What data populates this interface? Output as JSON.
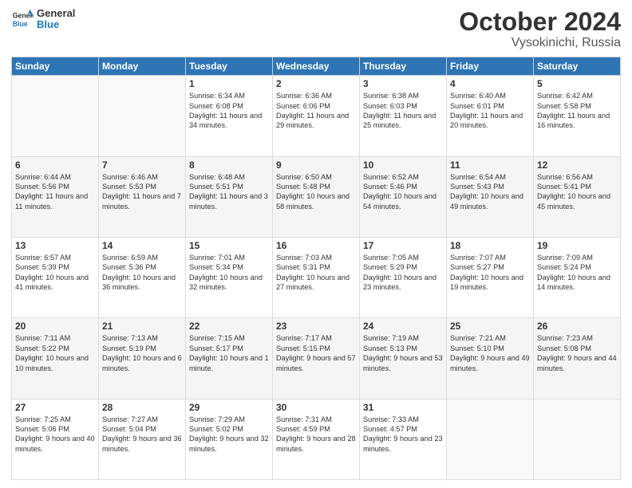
{
  "logo": {
    "line1": "General",
    "line2": "Blue"
  },
  "title": "October 2024",
  "subtitle": "Vysokinichi, Russia",
  "days_header": [
    "Sunday",
    "Monday",
    "Tuesday",
    "Wednesday",
    "Thursday",
    "Friday",
    "Saturday"
  ],
  "weeks": [
    [
      {
        "day": "",
        "sunrise": "",
        "sunset": "",
        "daylight": ""
      },
      {
        "day": "",
        "sunrise": "",
        "sunset": "",
        "daylight": ""
      },
      {
        "day": "1",
        "sunrise": "Sunrise: 6:34 AM",
        "sunset": "Sunset: 6:08 PM",
        "daylight": "Daylight: 11 hours and 34 minutes."
      },
      {
        "day": "2",
        "sunrise": "Sunrise: 6:36 AM",
        "sunset": "Sunset: 6:06 PM",
        "daylight": "Daylight: 11 hours and 29 minutes."
      },
      {
        "day": "3",
        "sunrise": "Sunrise: 6:38 AM",
        "sunset": "Sunset: 6:03 PM",
        "daylight": "Daylight: 11 hours and 25 minutes."
      },
      {
        "day": "4",
        "sunrise": "Sunrise: 6:40 AM",
        "sunset": "Sunset: 6:01 PM",
        "daylight": "Daylight: 11 hours and 20 minutes."
      },
      {
        "day": "5",
        "sunrise": "Sunrise: 6:42 AM",
        "sunset": "Sunset: 5:58 PM",
        "daylight": "Daylight: 11 hours and 16 minutes."
      }
    ],
    [
      {
        "day": "6",
        "sunrise": "Sunrise: 6:44 AM",
        "sunset": "Sunset: 5:56 PM",
        "daylight": "Daylight: 11 hours and 11 minutes."
      },
      {
        "day": "7",
        "sunrise": "Sunrise: 6:46 AM",
        "sunset": "Sunset: 5:53 PM",
        "daylight": "Daylight: 11 hours and 7 minutes."
      },
      {
        "day": "8",
        "sunrise": "Sunrise: 6:48 AM",
        "sunset": "Sunset: 5:51 PM",
        "daylight": "Daylight: 11 hours and 3 minutes."
      },
      {
        "day": "9",
        "sunrise": "Sunrise: 6:50 AM",
        "sunset": "Sunset: 5:48 PM",
        "daylight": "Daylight: 10 hours and 58 minutes."
      },
      {
        "day": "10",
        "sunrise": "Sunrise: 6:52 AM",
        "sunset": "Sunset: 5:46 PM",
        "daylight": "Daylight: 10 hours and 54 minutes."
      },
      {
        "day": "11",
        "sunrise": "Sunrise: 6:54 AM",
        "sunset": "Sunset: 5:43 PM",
        "daylight": "Daylight: 10 hours and 49 minutes."
      },
      {
        "day": "12",
        "sunrise": "Sunrise: 6:56 AM",
        "sunset": "Sunset: 5:41 PM",
        "daylight": "Daylight: 10 hours and 45 minutes."
      }
    ],
    [
      {
        "day": "13",
        "sunrise": "Sunrise: 6:57 AM",
        "sunset": "Sunset: 5:39 PM",
        "daylight": "Daylight: 10 hours and 41 minutes."
      },
      {
        "day": "14",
        "sunrise": "Sunrise: 6:59 AM",
        "sunset": "Sunset: 5:36 PM",
        "daylight": "Daylight: 10 hours and 36 minutes."
      },
      {
        "day": "15",
        "sunrise": "Sunrise: 7:01 AM",
        "sunset": "Sunset: 5:34 PM",
        "daylight": "Daylight: 10 hours and 32 minutes."
      },
      {
        "day": "16",
        "sunrise": "Sunrise: 7:03 AM",
        "sunset": "Sunset: 5:31 PM",
        "daylight": "Daylight: 10 hours and 27 minutes."
      },
      {
        "day": "17",
        "sunrise": "Sunrise: 7:05 AM",
        "sunset": "Sunset: 5:29 PM",
        "daylight": "Daylight: 10 hours and 23 minutes."
      },
      {
        "day": "18",
        "sunrise": "Sunrise: 7:07 AM",
        "sunset": "Sunset: 5:27 PM",
        "daylight": "Daylight: 10 hours and 19 minutes."
      },
      {
        "day": "19",
        "sunrise": "Sunrise: 7:09 AM",
        "sunset": "Sunset: 5:24 PM",
        "daylight": "Daylight: 10 hours and 14 minutes."
      }
    ],
    [
      {
        "day": "20",
        "sunrise": "Sunrise: 7:11 AM",
        "sunset": "Sunset: 5:22 PM",
        "daylight": "Daylight: 10 hours and 10 minutes."
      },
      {
        "day": "21",
        "sunrise": "Sunrise: 7:13 AM",
        "sunset": "Sunset: 5:19 PM",
        "daylight": "Daylight: 10 hours and 6 minutes."
      },
      {
        "day": "22",
        "sunrise": "Sunrise: 7:15 AM",
        "sunset": "Sunset: 5:17 PM",
        "daylight": "Daylight: 10 hours and 1 minute."
      },
      {
        "day": "23",
        "sunrise": "Sunrise: 7:17 AM",
        "sunset": "Sunset: 5:15 PM",
        "daylight": "Daylight: 9 hours and 57 minutes."
      },
      {
        "day": "24",
        "sunrise": "Sunrise: 7:19 AM",
        "sunset": "Sunset: 5:13 PM",
        "daylight": "Daylight: 9 hours and 53 minutes."
      },
      {
        "day": "25",
        "sunrise": "Sunrise: 7:21 AM",
        "sunset": "Sunset: 5:10 PM",
        "daylight": "Daylight: 9 hours and 49 minutes."
      },
      {
        "day": "26",
        "sunrise": "Sunrise: 7:23 AM",
        "sunset": "Sunset: 5:08 PM",
        "daylight": "Daylight: 9 hours and 44 minutes."
      }
    ],
    [
      {
        "day": "27",
        "sunrise": "Sunrise: 7:25 AM",
        "sunset": "Sunset: 5:06 PM",
        "daylight": "Daylight: 9 hours and 40 minutes."
      },
      {
        "day": "28",
        "sunrise": "Sunrise: 7:27 AM",
        "sunset": "Sunset: 5:04 PM",
        "daylight": "Daylight: 9 hours and 36 minutes."
      },
      {
        "day": "29",
        "sunrise": "Sunrise: 7:29 AM",
        "sunset": "Sunset: 5:02 PM",
        "daylight": "Daylight: 9 hours and 32 minutes."
      },
      {
        "day": "30",
        "sunrise": "Sunrise: 7:31 AM",
        "sunset": "Sunset: 4:59 PM",
        "daylight": "Daylight: 9 hours and 28 minutes."
      },
      {
        "day": "31",
        "sunrise": "Sunrise: 7:33 AM",
        "sunset": "Sunset: 4:57 PM",
        "daylight": "Daylight: 9 hours and 23 minutes."
      },
      {
        "day": "",
        "sunrise": "",
        "sunset": "",
        "daylight": ""
      },
      {
        "day": "",
        "sunrise": "",
        "sunset": "",
        "daylight": ""
      }
    ]
  ]
}
